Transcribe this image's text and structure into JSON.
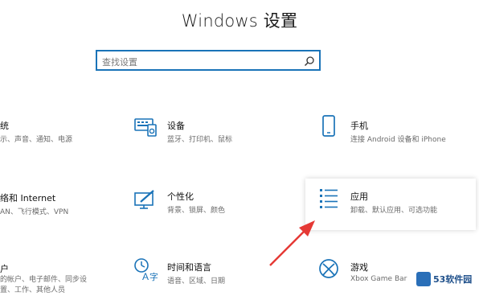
{
  "window": {
    "title": "Windows 设置"
  },
  "search": {
    "placeholder": "查找设置"
  },
  "tiles": {
    "system": {
      "name": "统",
      "desc": "示、声音、通知、电源"
    },
    "devices": {
      "name": "设备",
      "desc": "蓝牙、打印机、鼠标"
    },
    "phone": {
      "name": "手机",
      "desc": "连接 Android 设备和 iPhone"
    },
    "network": {
      "name": "络和 Internet",
      "desc": "AN、飞行模式、VPN"
    },
    "personalization": {
      "name": "个性化",
      "desc": "背景、锁屏、颜色"
    },
    "apps": {
      "name": "应用",
      "desc": "卸载、默认应用、可选功能"
    },
    "accounts": {
      "name": "户",
      "desc": "的帐户、电子邮件、同步设置、工作、其他人员"
    },
    "time": {
      "name": "时间和语言",
      "desc": "语音、区域、日期"
    },
    "gaming": {
      "name": "游戏",
      "desc": "Xbox Game Bar"
    }
  },
  "watermark": {
    "text": "53软件园"
  },
  "colors": {
    "accent": "#1a73b8",
    "arrow": "#e53935"
  }
}
